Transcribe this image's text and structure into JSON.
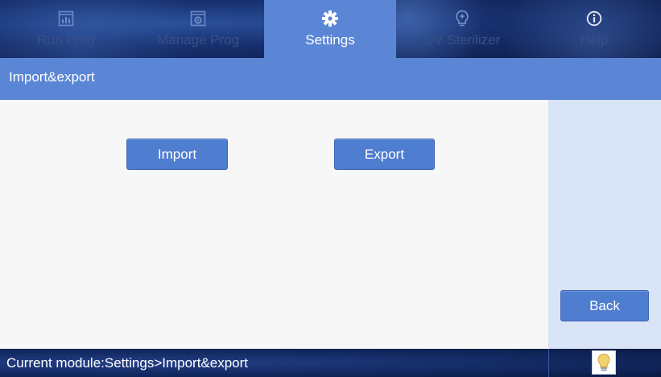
{
  "nav": {
    "tabs": [
      {
        "label": "Run Prog",
        "icon": "bar-chart-icon",
        "active": false
      },
      {
        "label": "Manage Prog",
        "icon": "gear-window-icon",
        "active": false
      },
      {
        "label": "Settings",
        "icon": "gear-icon",
        "active": true
      },
      {
        "label": "UV Sterilizer",
        "icon": "uv-bulb-icon",
        "active": false
      },
      {
        "label": "Help",
        "icon": "info-icon",
        "active": false
      }
    ]
  },
  "section": {
    "title": "Import&export"
  },
  "actions": {
    "import_label": "Import",
    "export_label": "Export",
    "back_label": "Back"
  },
  "status": {
    "text": "Current module:Settings>Import&export",
    "bulb_icon": "lightbulb-icon"
  },
  "colors": {
    "accent": "#5b86d6",
    "button": "#4f7dd0",
    "nav_dark": "#17306e",
    "side_panel": "#d9e4f7"
  }
}
